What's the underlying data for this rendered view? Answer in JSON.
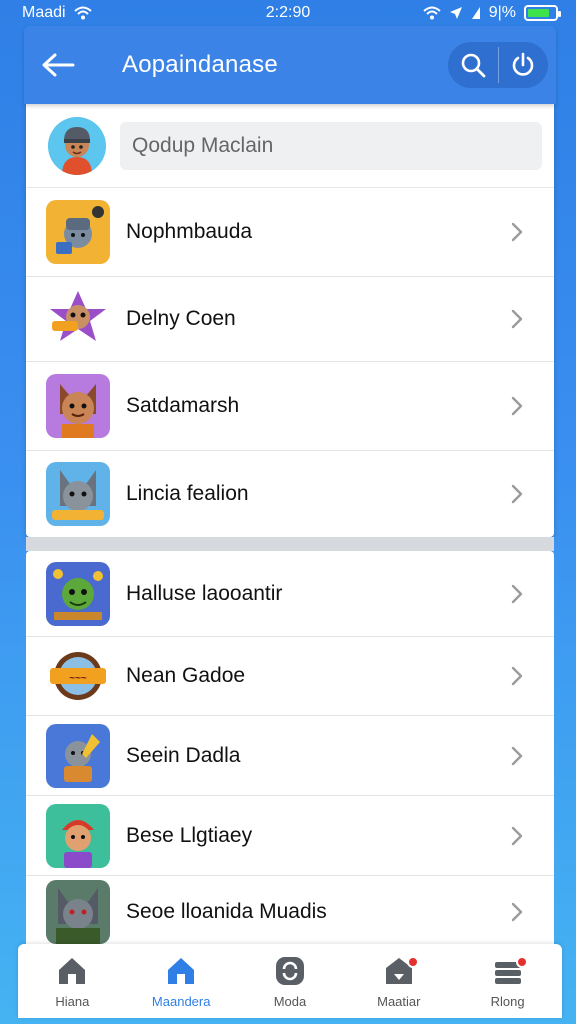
{
  "status_bar": {
    "carrier": "Maadi",
    "time": "2:2:90",
    "battery_text": "9|%",
    "battery_level": 0.8,
    "battery_color": "#3ee24a"
  },
  "header": {
    "title": "Aopaindanase",
    "back_icon": "arrow-left-icon",
    "actions": [
      "search-icon",
      "power-icon"
    ],
    "color": "#3b83e6"
  },
  "search": {
    "placeholder": "Qodup Maclain",
    "avatar_icon": "user-avatar"
  },
  "list_group_1": [
    {
      "label": "Nophmbauda",
      "icon": "game-icon-knight"
    },
    {
      "label": "Delny Coen",
      "icon": "game-icon-flower"
    },
    {
      "label": "Satdamarsh",
      "icon": "game-icon-cat"
    },
    {
      "label": "Lincia fealion",
      "icon": "game-icon-wolf"
    }
  ],
  "list_group_2": [
    {
      "label": "Halluse laooantir",
      "icon": "game-icon-goblin"
    },
    {
      "label": "Nean Gadoe",
      "icon": "game-icon-badge"
    },
    {
      "label": "Seein Dadla",
      "icon": "game-icon-warrior"
    },
    {
      "label": "Bese Llgtiaey",
      "icon": "game-icon-elf"
    },
    {
      "label": "Seoe lloanida Muadis",
      "icon": "game-icon-beast"
    }
  ],
  "bottom_nav": {
    "accent": "#2f7fe6",
    "items": [
      {
        "label": "Hiana",
        "icon": "home-icon",
        "active": false,
        "badge": false
      },
      {
        "label": "Maandera",
        "icon": "home-icon",
        "active": true,
        "badge": false
      },
      {
        "label": "Moda",
        "icon": "refresh-icon",
        "active": false,
        "badge": false
      },
      {
        "label": "Maatiar",
        "icon": "store-icon",
        "active": false,
        "badge": true
      },
      {
        "label": "Rlong",
        "icon": "stack-icon",
        "active": false,
        "badge": true
      }
    ]
  }
}
